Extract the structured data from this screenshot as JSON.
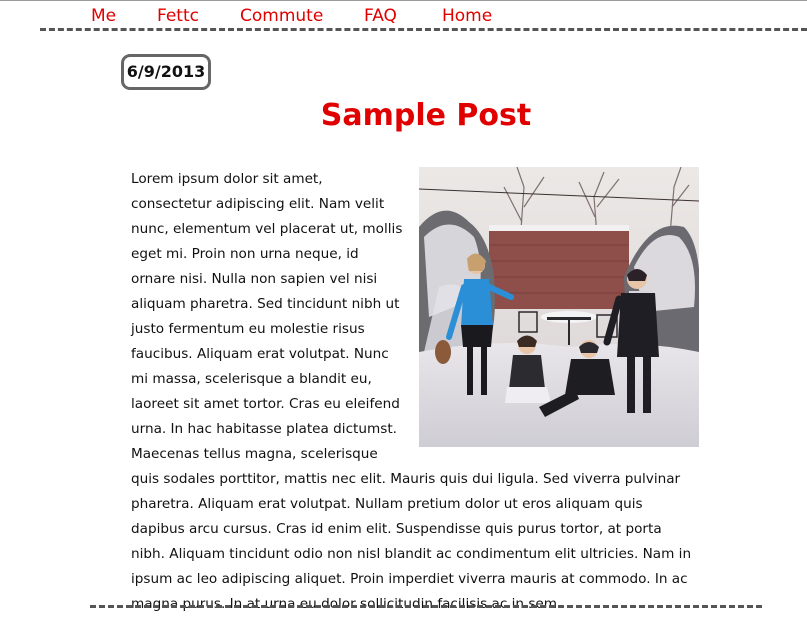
{
  "nav": {
    "items": [
      {
        "label": "Me"
      },
      {
        "label": "Fettc"
      },
      {
        "label": "Commute"
      },
      {
        "label": "FAQ"
      },
      {
        "label": "Home"
      }
    ]
  },
  "post": {
    "date": "6/9/2013",
    "title": "Sample Post",
    "image_alt": "Four people playing in the snow in a backyard",
    "body": "Lorem ipsum dolor sit amet, consectetur adipiscing elit. Nam velit nunc, elementum vel placerat ut, mollis eget mi. Proin non urna neque, id ornare nisi. Nulla non sapien vel nisi aliquam pharetra. Sed tincidunt nibh ut justo fermentum eu molestie risus faucibus. Aliquam erat volutpat. Nunc mi massa, scelerisque a blandit eu, laoreet sit amet tortor. Cras eu eleifend urna. In hac habitasse platea dictumst. Maecenas tellus magna, scelerisque quis sodales porttitor, mattis nec elit. Mauris quis dui ligula. Sed viverra pulvinar pharetra. Aliquam erat volutpat. Nullam pretium dolor ut eros aliquam quis dapibus arcu cursus. Cras id enim elit. Suspendisse quis purus tortor, at porta nibh. Aliquam tincidunt odio non nisl blandit ac condimentum elit ultricies. Nam in ipsum ac leo adipiscing aliquet. Proin imperdiet viverra mauris at commodo. In ac magna purus. In at urna eu dolor sollicitudin facilisis ac in sem."
  },
  "colors": {
    "accent": "#e00000",
    "divider": "#555555",
    "text": "#111111"
  }
}
